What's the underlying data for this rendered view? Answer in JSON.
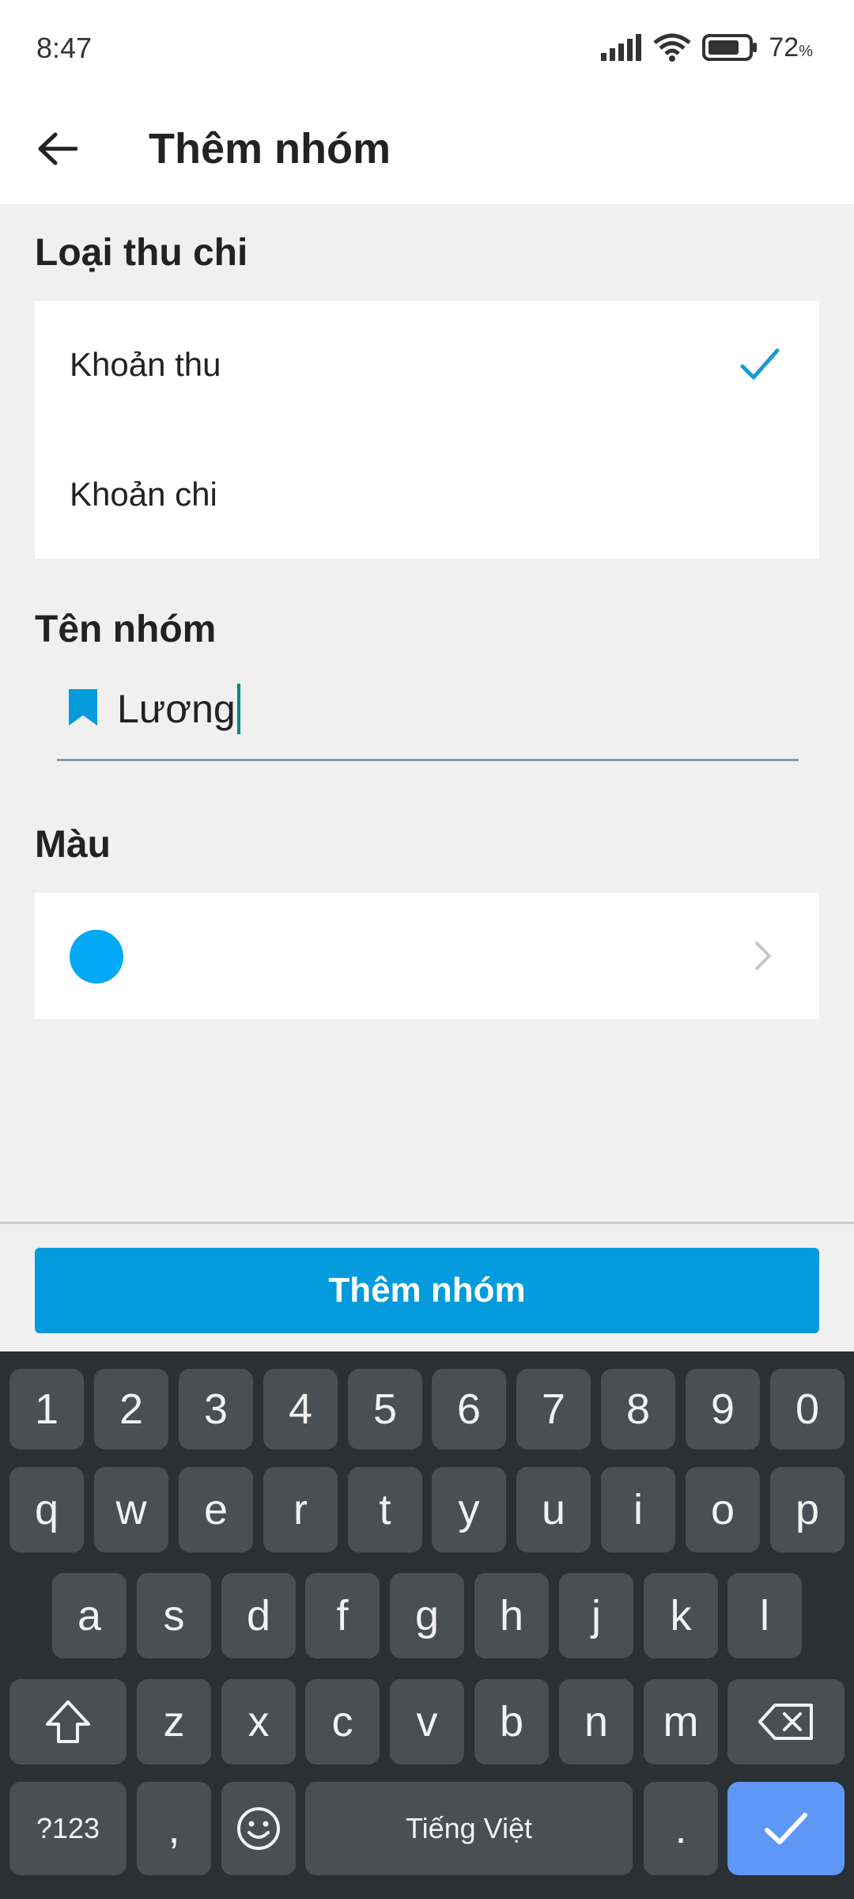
{
  "status": {
    "time": "8:47",
    "battery": "72",
    "battery_unit": "%"
  },
  "appbar": {
    "title": "Thêm nhóm"
  },
  "type_section": {
    "label": "Loại thu chi",
    "options": [
      {
        "label": "Khoản thu",
        "selected": true
      },
      {
        "label": "Khoản chi",
        "selected": false
      }
    ]
  },
  "name_section": {
    "label": "Tên nhóm",
    "value": "Lương"
  },
  "color_section": {
    "label": "Màu",
    "selected_color": "#03a9f4"
  },
  "primary_button": {
    "label": "Thêm nhóm"
  },
  "keyboard": {
    "row_numbers": [
      "1",
      "2",
      "3",
      "4",
      "5",
      "6",
      "7",
      "8",
      "9",
      "0"
    ],
    "row1": [
      "q",
      "w",
      "e",
      "r",
      "t",
      "y",
      "u",
      "i",
      "o",
      "p"
    ],
    "row2": [
      "a",
      "s",
      "d",
      "f",
      "g",
      "h",
      "j",
      "k",
      "l"
    ],
    "row3": [
      "z",
      "x",
      "c",
      "v",
      "b",
      "n",
      "m"
    ],
    "symbols_key": "?123",
    "comma_key": ",",
    "space_label": "Tiếng Việt",
    "period_key": "."
  },
  "colors": {
    "accent": "#039bdc",
    "check": "#1a9ad6"
  }
}
